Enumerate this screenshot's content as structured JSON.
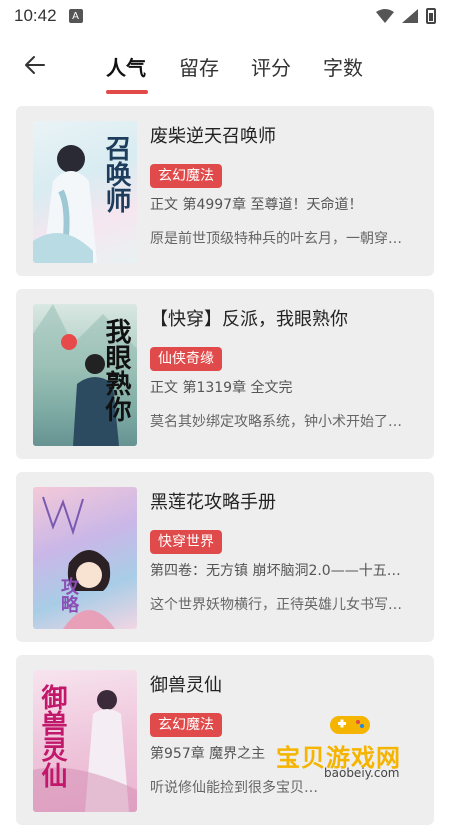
{
  "status_bar": {
    "time": "10:42",
    "notif_letter": "A"
  },
  "tabs": [
    {
      "label": "人气",
      "active": true
    },
    {
      "label": "留存",
      "active": false
    },
    {
      "label": "评分",
      "active": false
    },
    {
      "label": "字数",
      "active": false
    }
  ],
  "colors": {
    "accent": "#e14a46",
    "card_bg": "#eeeeee",
    "tag_bg": "#e04a4a"
  },
  "books": [
    {
      "title": "废柴逆天召唤师",
      "genre": "玄幻魔法",
      "chapter": "正文 第4997章 至尊道！天命道！",
      "desc": "原是前世顶级特种兵的叶玄月，一朝穿…",
      "cover_text": "召唤师"
    },
    {
      "title": "【快穿】反派，我眼熟你",
      "genre": "仙侠奇缘",
      "chapter": "正文 第1319章 全文完",
      "desc": "莫名其妙绑定攻略系统，钟小术开始了…",
      "cover_text": "我眼熟你"
    },
    {
      "title": "黑莲花攻略手册",
      "genre": "快穿世界",
      "chapter": "第四卷：无方镇 崩坏脑洞2.0——十五…",
      "desc": "这个世界妖物横行，正待英雄儿女书写…",
      "cover_text": "攻略"
    },
    {
      "title": "御兽灵仙",
      "genre": "玄幻魔法",
      "chapter": "第957章 魔界之主",
      "desc": "听说修仙能捡到很多宝贝…",
      "cover_text": "御兽灵仙"
    }
  ],
  "watermark": {
    "text": "宝贝游戏网",
    "url": "baobeiy.com"
  }
}
